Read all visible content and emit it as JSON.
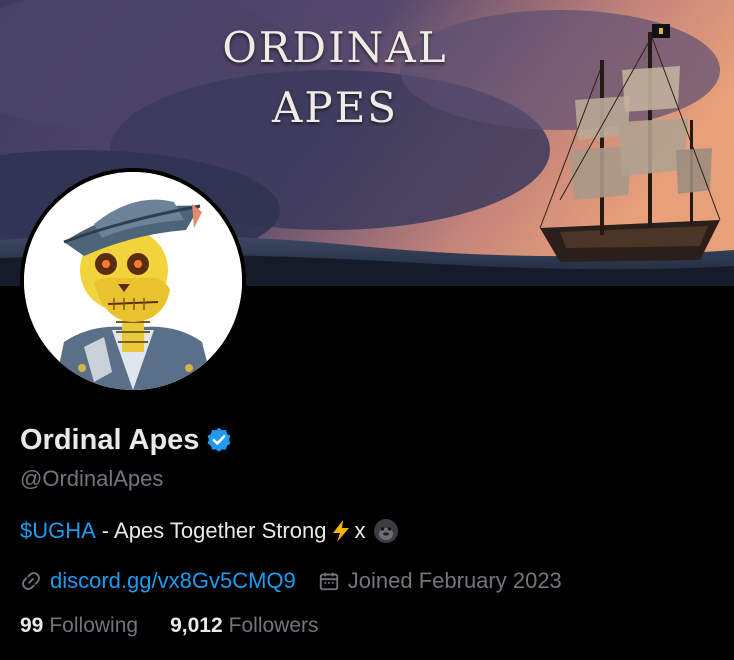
{
  "banner": {
    "title_line1": "ORDINAL",
    "title_line2": "APES"
  },
  "profile": {
    "name": "Ordinal Apes",
    "handle": "@OrdinalApes",
    "verified_icon": "verified-badge-icon",
    "bio": {
      "cashtag": "$UGHA",
      "text": "- Apes Together Strong",
      "emoji_bolt": "⚡",
      "x_text": "x",
      "emoji_gorilla": "gorilla-icon"
    },
    "link": "discord.gg/vx8Gv5CMQ9",
    "joined": "Joined February 2023",
    "following_count": "99",
    "following_label": "Following",
    "followers_count": "9,012",
    "followers_label": "Followers"
  },
  "colors": {
    "accent": "#1d9bf0",
    "muted": "#71767b",
    "text": "#e7e9ea",
    "background": "#000000"
  }
}
